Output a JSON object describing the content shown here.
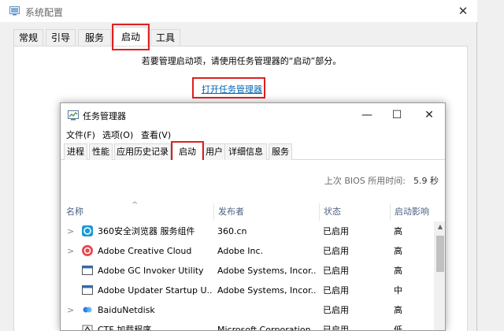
{
  "msconfig": {
    "title": "系统配置",
    "close": "✕",
    "tabs": [
      "常规",
      "引导",
      "服务",
      "启动",
      "工具"
    ],
    "active_tab": "启动",
    "message": "若要管理启动项，请使用任务管理器的“启动”部分。",
    "link": "打开任务管理器"
  },
  "taskmanager": {
    "title": "任务管理器",
    "controls": {
      "minimize": "—",
      "maximize": "☐",
      "close": "✕"
    },
    "menus": [
      "文件(F)",
      "选项(O)",
      "查看(V)"
    ],
    "tabs": [
      "进程",
      "性能",
      "应用历史记录",
      "启动",
      "用户",
      "详细信息",
      "服务"
    ],
    "active_tab": "启动",
    "bios_label": "上次 BIOS 所用时间:",
    "bios_value": "5.9 秒",
    "columns": {
      "name": "名称",
      "publisher": "发布者",
      "status": "状态",
      "impact": "启动影响"
    },
    "rows": [
      {
        "chevron": ">",
        "icon": "360-browser-icon",
        "name": "360安全浏览器 服务组件",
        "publisher": "360.cn",
        "status": "已启用",
        "impact": "高"
      },
      {
        "chevron": ">",
        "icon": "adobe-creative-cloud-icon",
        "name": "Adobe Creative Cloud",
        "publisher": "Adobe Inc.",
        "status": "已启用",
        "impact": "高"
      },
      {
        "chevron": "",
        "icon": "application-icon",
        "name": "Adobe GC Invoker Utility",
        "publisher": "Adobe Systems, Incor...",
        "status": "已启用",
        "impact": "高"
      },
      {
        "chevron": "",
        "icon": "application-icon",
        "name": "Adobe Updater Startup U...",
        "publisher": "Adobe Systems, Incor...",
        "status": "已启用",
        "impact": "中"
      },
      {
        "chevron": ">",
        "icon": "baidu-netdisk-icon",
        "name": "BaiduNetdisk",
        "publisher": "",
        "status": "已启用",
        "impact": "高"
      },
      {
        "chevron": "",
        "icon": "ctf-loader-icon",
        "name": "CTF 加载程序",
        "publisher": "Microsoft Corporation",
        "status": "已启用",
        "impact": "低"
      }
    ]
  },
  "colors": {
    "highlight": "#e02020",
    "link": "#0063b1",
    "header_text": "#4d6082"
  }
}
